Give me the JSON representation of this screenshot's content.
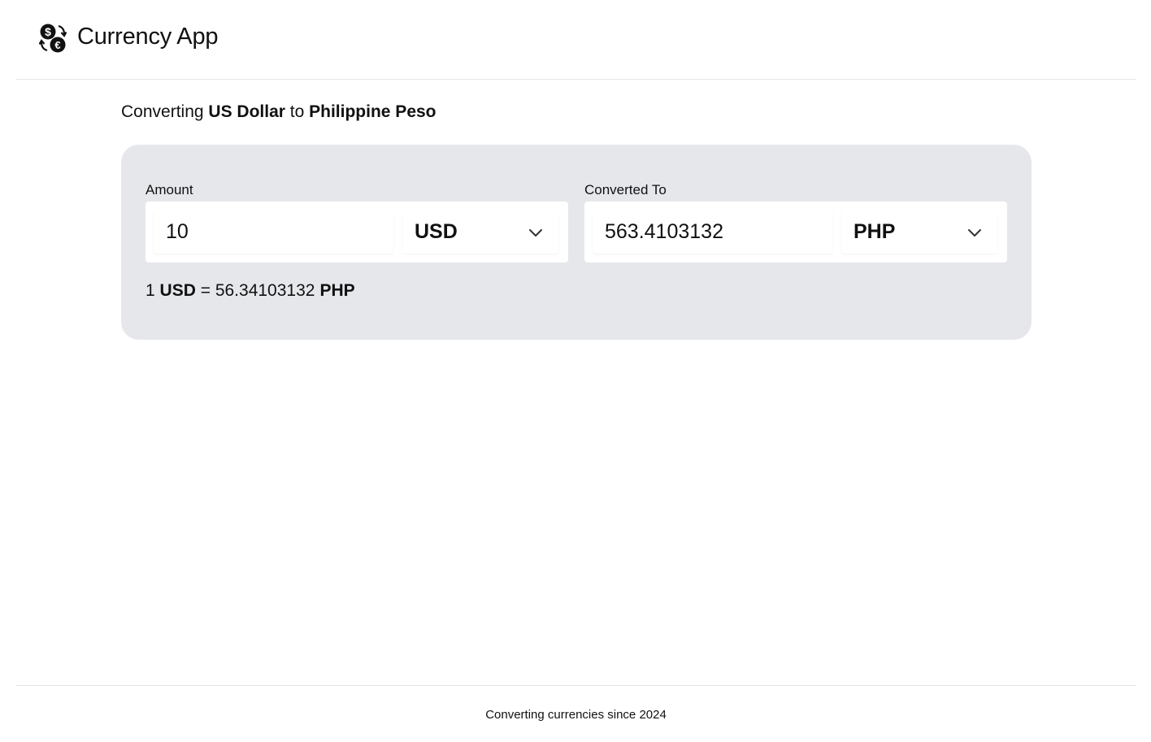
{
  "header": {
    "title": "Currency App",
    "logo_icon": "currency-exchange-icon"
  },
  "headline": {
    "prefix": "Converting",
    "from_name": "US Dollar",
    "joiner": "to",
    "to_name": "Philippine Peso"
  },
  "converter": {
    "amount": {
      "label": "Amount",
      "value": "10",
      "currency": "USD"
    },
    "converted": {
      "label": "Converted To",
      "value": "563.4103132",
      "currency": "PHP"
    },
    "rate": {
      "lhs_number": "1",
      "lhs_code": "USD",
      "equals": "=",
      "rhs_number": "56.34103132",
      "rhs_code": "PHP"
    }
  },
  "footer": {
    "text": "Converting currencies since 2024"
  },
  "colors": {
    "card_background": "#e5e7eb",
    "text": "#111111",
    "divider": "#e5e5e5"
  }
}
